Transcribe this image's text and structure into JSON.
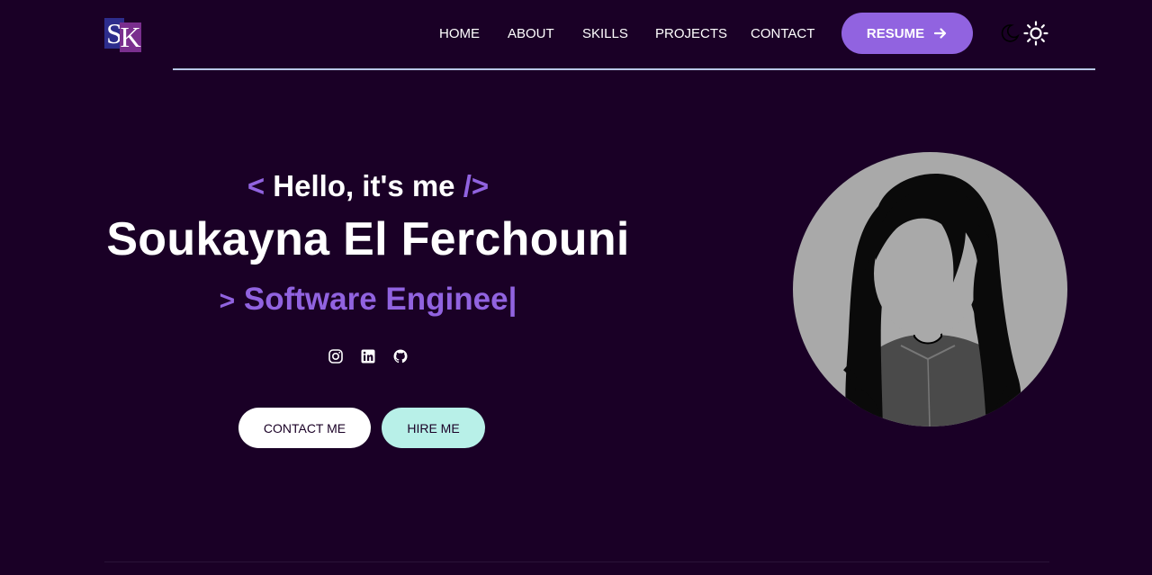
{
  "logo": {
    "letter1": "S",
    "letter2": "K"
  },
  "nav": {
    "items": [
      {
        "label": "HOME"
      },
      {
        "label": "ABOUT"
      },
      {
        "label": "SKILLS"
      },
      {
        "label": "PROJECTS"
      },
      {
        "label": "CONTACT"
      }
    ],
    "resume_label": "RESUME",
    "resume_icon": "arrow-right-icon",
    "theme_icons": [
      "moon-icon",
      "sun-icon"
    ]
  },
  "hero": {
    "greeting_open": "<",
    "greeting": " Hello, it's me ",
    "greeting_close": "/>",
    "name": "Soukayna El Ferchouni",
    "role_prefix": ">",
    "role": "Software Enginee|",
    "socials": [
      "instagram-icon",
      "linkedin-icon",
      "github-icon"
    ],
    "contact_label": "CONTACT ME",
    "hire_label": "HIRE ME"
  },
  "colors": {
    "background": "#1a0026",
    "accent": "#9163e0",
    "mint": "#b8f0e8",
    "rule": "#b7c6e6"
  }
}
